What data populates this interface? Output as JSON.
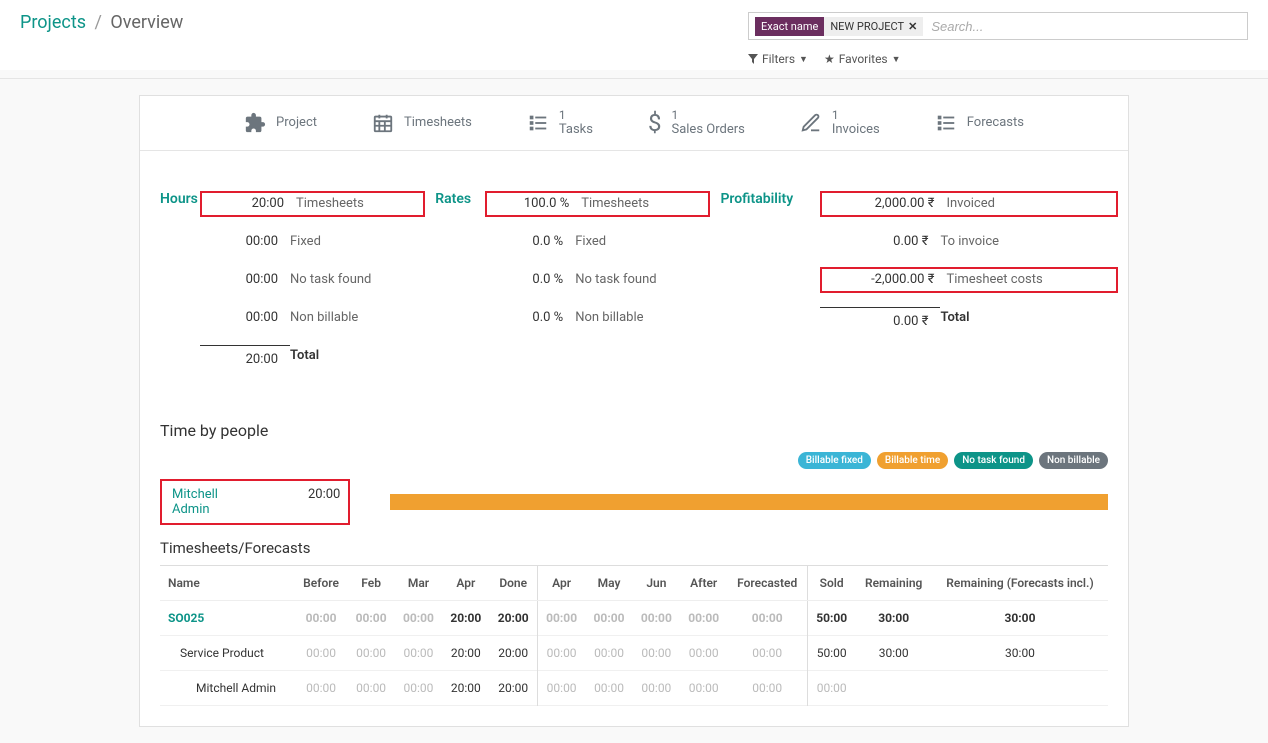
{
  "breadcrumb": {
    "link": "Projects",
    "current": "Overview"
  },
  "search": {
    "facet": "Exact name",
    "value": "NEW PROJECT",
    "placeholder": "Search...",
    "filters_label": "Filters",
    "favorites_label": "Favorites"
  },
  "nav": {
    "project": "Project",
    "timesheets": "Timesheets",
    "tasks_count": "1",
    "tasks": "Tasks",
    "so_count": "1",
    "so": "Sales Orders",
    "inv_count": "1",
    "inv": "Invoices",
    "forecasts": "Forecasts"
  },
  "hours": {
    "title": "Hours",
    "rows": [
      {
        "val": "20:00",
        "lbl": "Timesheets",
        "box": true
      },
      {
        "val": "00:00",
        "lbl": "Fixed"
      },
      {
        "val": "00:00",
        "lbl": "No task found"
      },
      {
        "val": "00:00",
        "lbl": "Non billable"
      }
    ],
    "total_val": "20:00",
    "total_lbl": "Total"
  },
  "rates": {
    "title": "Rates",
    "rows": [
      {
        "val": "100.0 %",
        "lbl": "Timesheets",
        "box": true
      },
      {
        "val": "0.0 %",
        "lbl": "Fixed"
      },
      {
        "val": "0.0 %",
        "lbl": "No task found"
      },
      {
        "val": "0.0 %",
        "lbl": "Non billable"
      }
    ]
  },
  "profitability": {
    "title": "Profitability",
    "rows": [
      {
        "val": "2,000.00 ₹",
        "lbl": "Invoiced",
        "box": true
      },
      {
        "val": "0.00 ₹",
        "lbl": "To invoice"
      },
      {
        "val": "-2,000.00 ₹",
        "lbl": "Timesheet costs",
        "box": true
      }
    ],
    "total_val": "0.00 ₹",
    "total_lbl": "Total"
  },
  "time_by_people": {
    "title": "Time by people",
    "badges": [
      "Billable fixed",
      "Billable time",
      "No task found",
      "Non billable"
    ],
    "person_name": "Mitchell Admin",
    "person_hours": "20:00"
  },
  "tf": {
    "title": "Timesheets/Forecasts",
    "headers": [
      "Name",
      "Before",
      "Feb",
      "Mar",
      "Apr",
      "Done",
      "Apr",
      "May",
      "Jun",
      "After",
      "Forecasted",
      "Sold",
      "Remaining",
      "Remaining (Forecasts incl.)"
    ],
    "rows": [
      {
        "name": "SO025",
        "link": true,
        "indent": 0,
        "bold": true,
        "cells": [
          "00:00",
          "00:00",
          "00:00",
          "20:00",
          "20:00",
          "00:00",
          "00:00",
          "00:00",
          "00:00",
          "00:00",
          "50:00",
          "30:00",
          "30:00"
        ],
        "muted": [
          0,
          1,
          2,
          5,
          6,
          7,
          8,
          9
        ]
      },
      {
        "name": "Service Product",
        "indent": 1,
        "cells": [
          "00:00",
          "00:00",
          "00:00",
          "20:00",
          "20:00",
          "00:00",
          "00:00",
          "00:00",
          "00:00",
          "00:00",
          "50:00",
          "30:00",
          "30:00"
        ],
        "muted": [
          0,
          1,
          2,
          5,
          6,
          7,
          8,
          9
        ]
      },
      {
        "name": "Mitchell Admin",
        "indent": 2,
        "cells": [
          "00:00",
          "00:00",
          "00:00",
          "20:00",
          "20:00",
          "00:00",
          "00:00",
          "00:00",
          "00:00",
          "00:00",
          "00:00",
          "",
          ""
        ],
        "muted": [
          0,
          1,
          2,
          5,
          6,
          7,
          8,
          9,
          10
        ]
      }
    ]
  }
}
